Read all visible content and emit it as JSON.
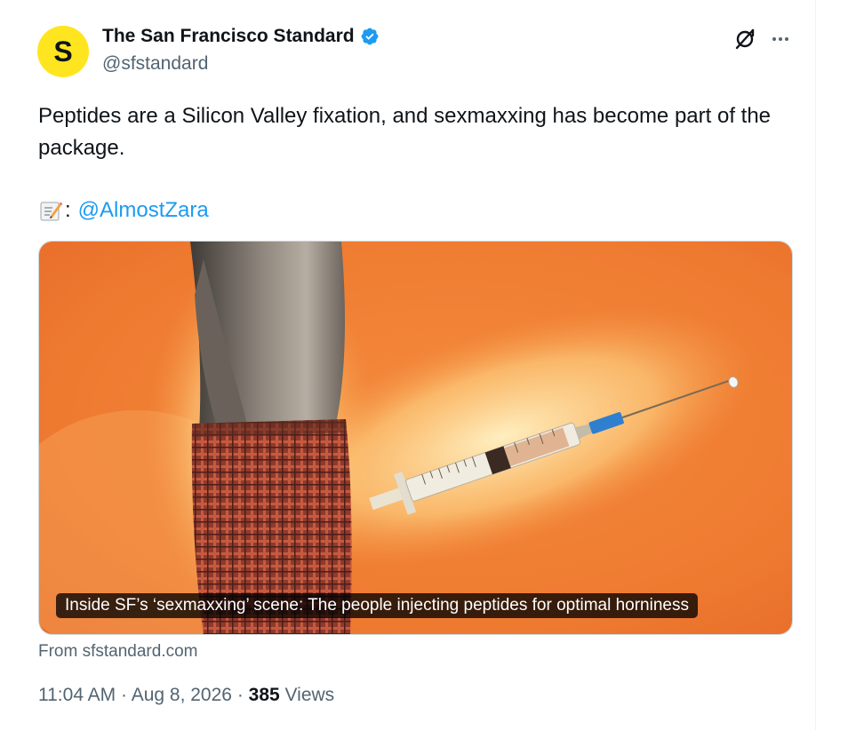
{
  "author": {
    "avatar_letter": "S",
    "display_name": "The San Francisco Standard",
    "handle": "@sfstandard",
    "verified": true
  },
  "icons": {
    "grok": "grok-icon",
    "more": "more-icon",
    "memo": "memo-emoji"
  },
  "tweet": {
    "text": "Peptides are a Silicon Valley fixation, and sexmaxxing has become part of the package.",
    "credit_separator": ":",
    "credit_mention": "@AlmostZara"
  },
  "card": {
    "caption": "Inside SF’s ‘sexmaxxing’ scene: The people injecting peptides for optimal horniness",
    "from_prefix": "From",
    "domain": "sfstandard.com"
  },
  "meta": {
    "time": "11:04 AM",
    "separator": "·",
    "date": "Aug 8, 2026",
    "views_count": "385",
    "views_label": "Views"
  },
  "colors": {
    "accent": "#1d9bf0",
    "avatar_bg": "#ffe51f",
    "secondary_text": "#536471",
    "card_bg": "#f07a2e"
  }
}
